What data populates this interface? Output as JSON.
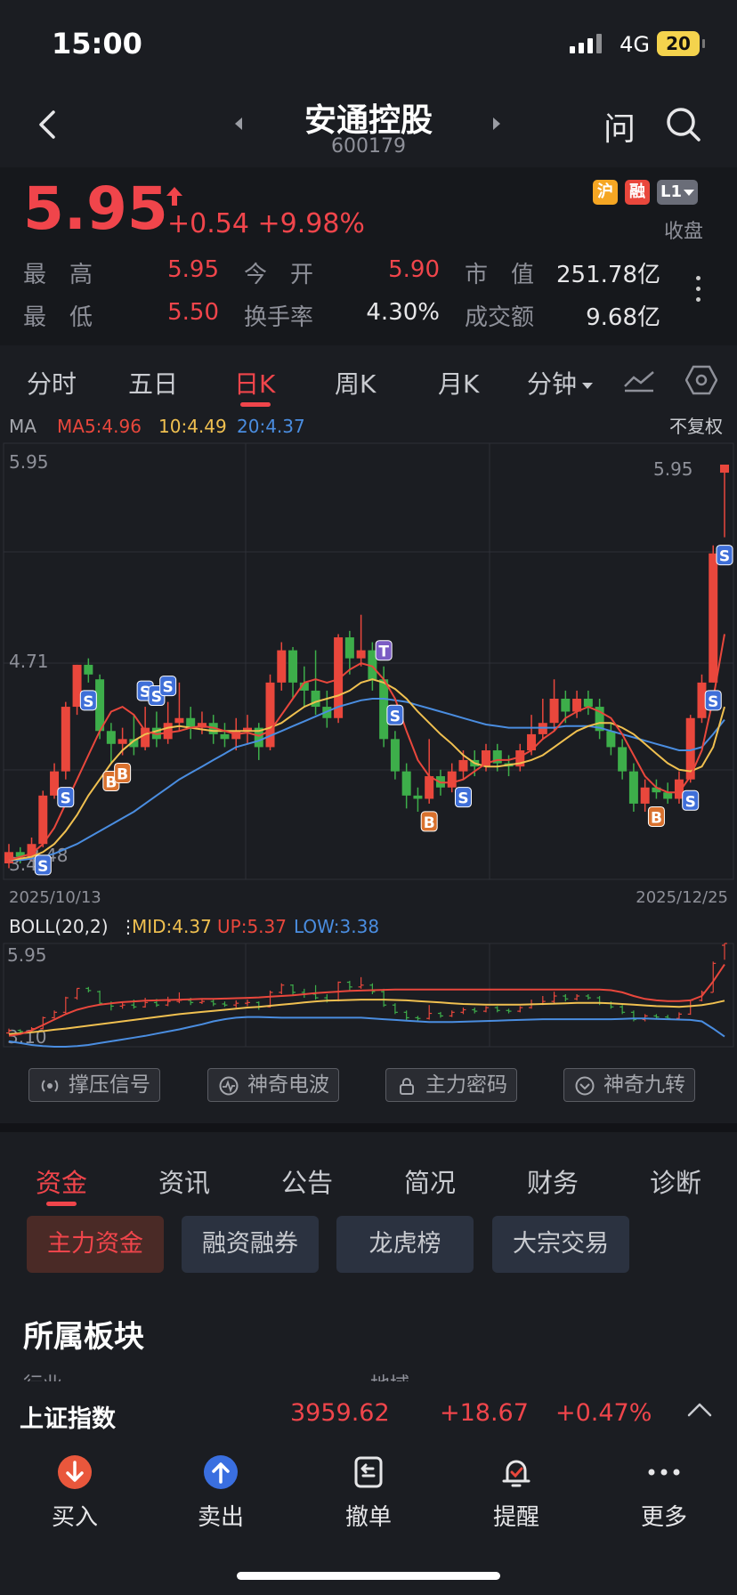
{
  "status": {
    "time": "15:00",
    "network": "4G",
    "battery": "20"
  },
  "nav": {
    "title": "安通控股",
    "code": "600179",
    "ask_label": "问"
  },
  "quote": {
    "price": "5.95",
    "change": "+0.54",
    "change_pct": "+9.98%",
    "badges": [
      {
        "text": "沪",
        "color": "#f5a623"
      },
      {
        "text": "融",
        "color": "#e9473c"
      },
      {
        "text": "L1",
        "color": "#6a6d78"
      }
    ],
    "status": "收盘",
    "rows": [
      [
        {
          "label": "最　高",
          "value": "5.95",
          "red": true
        },
        {
          "label": "今　开",
          "value": "5.90",
          "red": true
        },
        {
          "label": "市　值",
          "value": "251.78亿",
          "red": false
        }
      ],
      [
        {
          "label": "最　低",
          "value": "5.50",
          "red": true
        },
        {
          "label": "换手率",
          "value": "4.30%",
          "red": false
        },
        {
          "label": "成交额",
          "value": "9.68亿",
          "red": false
        }
      ]
    ]
  },
  "ktabs": {
    "tabs": [
      "分时",
      "五日",
      "日K",
      "周K",
      "月K",
      "分钟"
    ],
    "active": 2
  },
  "ma_legend": {
    "label": "MA",
    "ma5": "MA5:4.96",
    "ma10": "10:4.49",
    "ma20": "20:4.37",
    "adjust": "不复权"
  },
  "boll_legend": {
    "label": "BOLL(20,2)",
    "mid": "MID:4.37",
    "up": "UP:5.37",
    "low": "LOW:3.38"
  },
  "colors": {
    "up": "#e9473c",
    "down": "#3dae4a",
    "ma5": "#e9473c",
    "ma10": "#f0c050",
    "ma20": "#4a8de0",
    "grid": "#2e3037"
  },
  "chart_data": {
    "type": "candlestick",
    "title": "",
    "date_start": "2025/10/13",
    "date_end": "2025/12/25",
    "y_labels": {
      "top": "5.95",
      "mid": "4.71",
      "bottom": "3.48"
    },
    "low_marker": "3.48",
    "high_marker": "5.95",
    "boll_top_label": "5.95",
    "boll_bottom_label": "3.10",
    "ylim": [
      3.48,
      5.95
    ],
    "candles": [
      {
        "o": 3.48,
        "c": 3.55,
        "h": 3.6,
        "l": 3.45
      },
      {
        "o": 3.55,
        "c": 3.52,
        "h": 3.58,
        "l": 3.48
      },
      {
        "o": 3.52,
        "c": 3.6,
        "h": 3.64,
        "l": 3.5
      },
      {
        "o": 3.6,
        "c": 3.9,
        "h": 3.93,
        "l": 3.58
      },
      {
        "o": 3.9,
        "c": 4.05,
        "h": 4.1,
        "l": 3.88
      },
      {
        "o": 4.05,
        "c": 4.45,
        "h": 4.48,
        "l": 4.0
      },
      {
        "o": 4.45,
        "c": 4.71,
        "h": 4.71,
        "l": 4.4
      },
      {
        "o": 4.71,
        "c": 4.65,
        "h": 4.75,
        "l": 4.6
      },
      {
        "o": 4.62,
        "c": 4.3,
        "h": 4.65,
        "l": 4.25
      },
      {
        "o": 4.3,
        "c": 4.22,
        "h": 4.35,
        "l": 4.1
      },
      {
        "o": 4.22,
        "c": 4.25,
        "h": 4.32,
        "l": 4.15
      },
      {
        "o": 4.25,
        "c": 4.2,
        "h": 4.4,
        "l": 4.15
      },
      {
        "o": 4.2,
        "c": 4.32,
        "h": 4.45,
        "l": 4.18
      },
      {
        "o": 4.32,
        "c": 4.25,
        "h": 4.42,
        "l": 4.2
      },
      {
        "o": 4.25,
        "c": 4.35,
        "h": 4.48,
        "l": 4.22
      },
      {
        "o": 4.35,
        "c": 4.38,
        "h": 4.6,
        "l": 4.3
      },
      {
        "o": 4.38,
        "c": 4.32,
        "h": 4.45,
        "l": 4.25
      },
      {
        "o": 4.32,
        "c": 4.35,
        "h": 4.42,
        "l": 4.28
      },
      {
        "o": 4.35,
        "c": 4.28,
        "h": 4.4,
        "l": 4.22
      },
      {
        "o": 4.28,
        "c": 4.25,
        "h": 4.35,
        "l": 4.2
      },
      {
        "o": 4.25,
        "c": 4.3,
        "h": 4.38,
        "l": 4.18
      },
      {
        "o": 4.3,
        "c": 4.32,
        "h": 4.4,
        "l": 4.22
      },
      {
        "o": 4.32,
        "c": 4.2,
        "h": 4.35,
        "l": 4.12
      },
      {
        "o": 4.2,
        "c": 4.6,
        "h": 4.65,
        "l": 4.18
      },
      {
        "o": 4.6,
        "c": 4.8,
        "h": 4.85,
        "l": 4.55
      },
      {
        "o": 4.8,
        "c": 4.6,
        "h": 4.82,
        "l": 4.5
      },
      {
        "o": 4.6,
        "c": 4.55,
        "h": 4.7,
        "l": 4.45
      },
      {
        "o": 4.55,
        "c": 4.45,
        "h": 4.8,
        "l": 4.4
      },
      {
        "o": 4.45,
        "c": 4.38,
        "h": 4.55,
        "l": 4.32
      },
      {
        "o": 4.38,
        "c": 4.88,
        "h": 4.9,
        "l": 4.35
      },
      {
        "o": 4.88,
        "c": 4.75,
        "h": 4.92,
        "l": 4.65
      },
      {
        "o": 4.75,
        "c": 4.8,
        "h": 5.02,
        "l": 4.7
      },
      {
        "o": 4.8,
        "c": 4.62,
        "h": 4.85,
        "l": 4.55
      },
      {
        "o": 4.62,
        "c": 4.25,
        "h": 4.7,
        "l": 4.2
      },
      {
        "o": 4.25,
        "c": 4.05,
        "h": 4.3,
        "l": 4.0
      },
      {
        "o": 4.05,
        "c": 3.9,
        "h": 4.1,
        "l": 3.82
      },
      {
        "o": 3.9,
        "c": 3.88,
        "h": 3.95,
        "l": 3.8
      },
      {
        "o": 3.88,
        "c": 4.02,
        "h": 4.25,
        "l": 3.85
      },
      {
        "o": 4.02,
        "c": 3.95,
        "h": 4.06,
        "l": 3.9
      },
      {
        "o": 3.95,
        "c": 4.05,
        "h": 4.1,
        "l": 3.92
      },
      {
        "o": 4.05,
        "c": 4.12,
        "h": 4.18,
        "l": 4.0
      },
      {
        "o": 4.12,
        "c": 4.08,
        "h": 4.18,
        "l": 4.02
      },
      {
        "o": 4.08,
        "c": 4.18,
        "h": 4.22,
        "l": 4.05
      },
      {
        "o": 4.18,
        "c": 4.1,
        "h": 4.22,
        "l": 4.05
      },
      {
        "o": 4.1,
        "c": 4.08,
        "h": 4.15,
        "l": 4.02
      },
      {
        "o": 4.08,
        "c": 4.18,
        "h": 4.22,
        "l": 4.05
      },
      {
        "o": 4.18,
        "c": 4.28,
        "h": 4.4,
        "l": 4.15
      },
      {
        "o": 4.28,
        "c": 4.35,
        "h": 4.5,
        "l": 4.25
      },
      {
        "o": 4.35,
        "c": 4.5,
        "h": 4.62,
        "l": 4.3
      },
      {
        "o": 4.5,
        "c": 4.42,
        "h": 4.55,
        "l": 4.35
      },
      {
        "o": 4.42,
        "c": 4.5,
        "h": 4.55,
        "l": 4.38
      },
      {
        "o": 4.5,
        "c": 4.45,
        "h": 4.55,
        "l": 4.4
      },
      {
        "o": 4.45,
        "c": 4.3,
        "h": 4.5,
        "l": 4.25
      },
      {
        "o": 4.3,
        "c": 4.2,
        "h": 4.35,
        "l": 4.15
      },
      {
        "o": 4.2,
        "c": 4.05,
        "h": 4.25,
        "l": 4.0
      },
      {
        "o": 4.05,
        "c": 3.85,
        "h": 4.1,
        "l": 3.8
      },
      {
        "o": 3.85,
        "c": 3.95,
        "h": 4.0,
        "l": 3.8
      },
      {
        "o": 3.95,
        "c": 3.92,
        "h": 4.0,
        "l": 3.88
      },
      {
        "o": 3.92,
        "c": 3.88,
        "h": 3.98,
        "l": 3.85
      },
      {
        "o": 3.88,
        "c": 4.0,
        "h": 4.05,
        "l": 3.85
      },
      {
        "o": 4.0,
        "c": 4.38,
        "h": 4.4,
        "l": 3.98
      },
      {
        "o": 4.38,
        "c": 4.6,
        "h": 4.65,
        "l": 4.35
      },
      {
        "o": 4.6,
        "c": 5.4,
        "h": 5.45,
        "l": 4.6
      },
      {
        "o": 5.9,
        "c": 5.95,
        "h": 5.95,
        "l": 5.5
      }
    ],
    "ma5": [
      3.5,
      3.52,
      3.54,
      3.6,
      3.7,
      3.85,
      4.0,
      4.15,
      4.3,
      4.42,
      4.45,
      4.4,
      4.3,
      4.28,
      4.29,
      4.3,
      4.32,
      4.33,
      4.32,
      4.3,
      4.28,
      4.29,
      4.27,
      4.3,
      4.4,
      4.5,
      4.6,
      4.62,
      4.6,
      4.62,
      4.68,
      4.72,
      4.7,
      4.62,
      4.5,
      4.3,
      4.12,
      4.02,
      3.98,
      3.98,
      4.0,
      4.05,
      4.1,
      4.12,
      4.12,
      4.14,
      4.18,
      4.25,
      4.3,
      4.38,
      4.42,
      4.45,
      4.42,
      4.38,
      4.28,
      4.15,
      4.02,
      3.95,
      3.92,
      3.92,
      4.02,
      4.18,
      4.5,
      4.9
    ],
    "ma10": [
      3.5,
      3.51,
      3.52,
      3.55,
      3.6,
      3.68,
      3.78,
      3.9,
      4.0,
      4.1,
      4.18,
      4.24,
      4.28,
      4.3,
      4.32,
      4.33,
      4.32,
      4.31,
      4.3,
      4.3,
      4.3,
      4.3,
      4.3,
      4.32,
      4.35,
      4.4,
      4.45,
      4.48,
      4.5,
      4.52,
      4.55,
      4.6,
      4.62,
      4.6,
      4.56,
      4.5,
      4.42,
      4.35,
      4.28,
      4.22,
      4.15,
      4.1,
      4.08,
      4.08,
      4.09,
      4.1,
      4.12,
      4.15,
      4.2,
      4.25,
      4.3,
      4.33,
      4.35,
      4.35,
      4.32,
      4.28,
      4.22,
      4.16,
      4.1,
      4.06,
      4.05,
      4.08,
      4.2,
      4.45
    ],
    "ma20": [
      3.5,
      3.5,
      3.51,
      3.52,
      3.54,
      3.57,
      3.6,
      3.64,
      3.68,
      3.72,
      3.76,
      3.8,
      3.85,
      3.9,
      3.95,
      4.0,
      4.04,
      4.08,
      4.12,
      4.16,
      4.2,
      4.22,
      4.24,
      4.27,
      4.3,
      4.33,
      4.36,
      4.39,
      4.42,
      4.45,
      4.47,
      4.49,
      4.5,
      4.5,
      4.49,
      4.48,
      4.46,
      4.44,
      4.42,
      4.4,
      4.38,
      4.36,
      4.34,
      4.33,
      4.32,
      4.32,
      4.32,
      4.32,
      4.32,
      4.33,
      4.33,
      4.33,
      4.32,
      4.3,
      4.28,
      4.26,
      4.24,
      4.22,
      4.2,
      4.18,
      4.18,
      4.2,
      4.28,
      4.37
    ],
    "signals": [
      {
        "i": 3,
        "t": "S",
        "pos": "below"
      },
      {
        "i": 5,
        "t": "S",
        "pos": "below"
      },
      {
        "i": 7,
        "t": "S",
        "pos": "below"
      },
      {
        "i": 9,
        "t": "B",
        "pos": "below"
      },
      {
        "i": 10,
        "t": "B",
        "pos": "below"
      },
      {
        "i": 12,
        "t": "S",
        "pos": "above"
      },
      {
        "i": 13,
        "t": "S",
        "pos": "above"
      },
      {
        "i": 14,
        "t": "S",
        "pos": "above"
      },
      {
        "i": 33,
        "t": "T",
        "pos": "above"
      },
      {
        "i": 34,
        "t": "S",
        "pos": "above"
      },
      {
        "i": 37,
        "t": "B",
        "pos": "below"
      },
      {
        "i": 40,
        "t": "S",
        "pos": "below"
      },
      {
        "i": 57,
        "t": "B",
        "pos": "below"
      },
      {
        "i": 60,
        "t": "S",
        "pos": "below"
      },
      {
        "i": 62,
        "t": "S",
        "pos": "below"
      },
      {
        "i": 63,
        "t": "S",
        "pos": "below"
      }
    ],
    "boll": {
      "ylim": [
        3.1,
        5.95
      ],
      "up": [
        3.4,
        3.45,
        3.55,
        3.7,
        3.85,
        4.0,
        4.12,
        4.2,
        4.26,
        4.3,
        4.33,
        4.35,
        4.37,
        4.38,
        4.39,
        4.4,
        4.41,
        4.42,
        4.42,
        4.43,
        4.44,
        4.45,
        4.46,
        4.48,
        4.5,
        4.52,
        4.55,
        4.58,
        4.6,
        4.62,
        4.64,
        4.65,
        4.66,
        4.67,
        4.68,
        4.68,
        4.68,
        4.68,
        4.68,
        4.68,
        4.68,
        4.68,
        4.68,
        4.68,
        4.68,
        4.68,
        4.68,
        4.68,
        4.68,
        4.68,
        4.68,
        4.68,
        4.68,
        4.66,
        4.6,
        4.5,
        4.42,
        4.38,
        4.36,
        4.36,
        4.38,
        4.5,
        4.9,
        5.37
      ],
      "mid": [
        3.45,
        3.47,
        3.5,
        3.53,
        3.57,
        3.6,
        3.64,
        3.68,
        3.72,
        3.76,
        3.8,
        3.84,
        3.88,
        3.92,
        3.96,
        4.0,
        4.03,
        4.06,
        4.09,
        4.12,
        4.15,
        4.18,
        4.2,
        4.23,
        4.26,
        4.29,
        4.32,
        4.35,
        4.37,
        4.38,
        4.39,
        4.4,
        4.4,
        4.4,
        4.39,
        4.38,
        4.36,
        4.34,
        4.32,
        4.3,
        4.28,
        4.27,
        4.26,
        4.26,
        4.26,
        4.26,
        4.27,
        4.28,
        4.29,
        4.3,
        4.31,
        4.31,
        4.31,
        4.3,
        4.28,
        4.26,
        4.24,
        4.22,
        4.21,
        4.2,
        4.22,
        4.25,
        4.3,
        4.37
      ],
      "low": [
        3.25,
        3.2,
        3.15,
        3.12,
        3.1,
        3.1,
        3.12,
        3.15,
        3.2,
        3.25,
        3.3,
        3.35,
        3.4,
        3.46,
        3.52,
        3.58,
        3.65,
        3.72,
        3.8,
        3.86,
        3.9,
        3.92,
        3.92,
        3.91,
        3.9,
        3.9,
        3.9,
        3.9,
        3.9,
        3.9,
        3.9,
        3.9,
        3.88,
        3.86,
        3.84,
        3.82,
        3.8,
        3.78,
        3.78,
        3.78,
        3.79,
        3.8,
        3.81,
        3.82,
        3.83,
        3.84,
        3.85,
        3.86,
        3.86,
        3.86,
        3.86,
        3.86,
        3.86,
        3.86,
        3.87,
        3.88,
        3.88,
        3.87,
        3.86,
        3.85,
        3.84,
        3.8,
        3.6,
        3.38
      ]
    }
  },
  "indicators": [
    "撑压信号",
    "神奇电波",
    "主力密码",
    "神奇九转"
  ],
  "info_tabs": {
    "tabs": [
      "资金",
      "资讯",
      "公告",
      "简况",
      "财务",
      "诊断"
    ],
    "active": 0
  },
  "sub_tabs": {
    "tabs": [
      "主力资金",
      "融资融券",
      "龙虎榜",
      "大宗交易"
    ],
    "active": 0
  },
  "section": {
    "title": "所属板块",
    "col1": "行业",
    "col2": "地域"
  },
  "index_bar": {
    "name": "上证指数",
    "value": "3959.62",
    "change": "+18.67",
    "pct": "+0.47%"
  },
  "bottom": [
    {
      "label": "买入",
      "icon": "buy-icon",
      "color": "#e9573c"
    },
    {
      "label": "卖出",
      "icon": "sell-icon",
      "color": "#3a6fe0"
    },
    {
      "label": "撤单",
      "icon": "cancel-order-icon"
    },
    {
      "label": "提醒",
      "icon": "bell-icon"
    },
    {
      "label": "更多",
      "icon": "more-icon"
    }
  ]
}
